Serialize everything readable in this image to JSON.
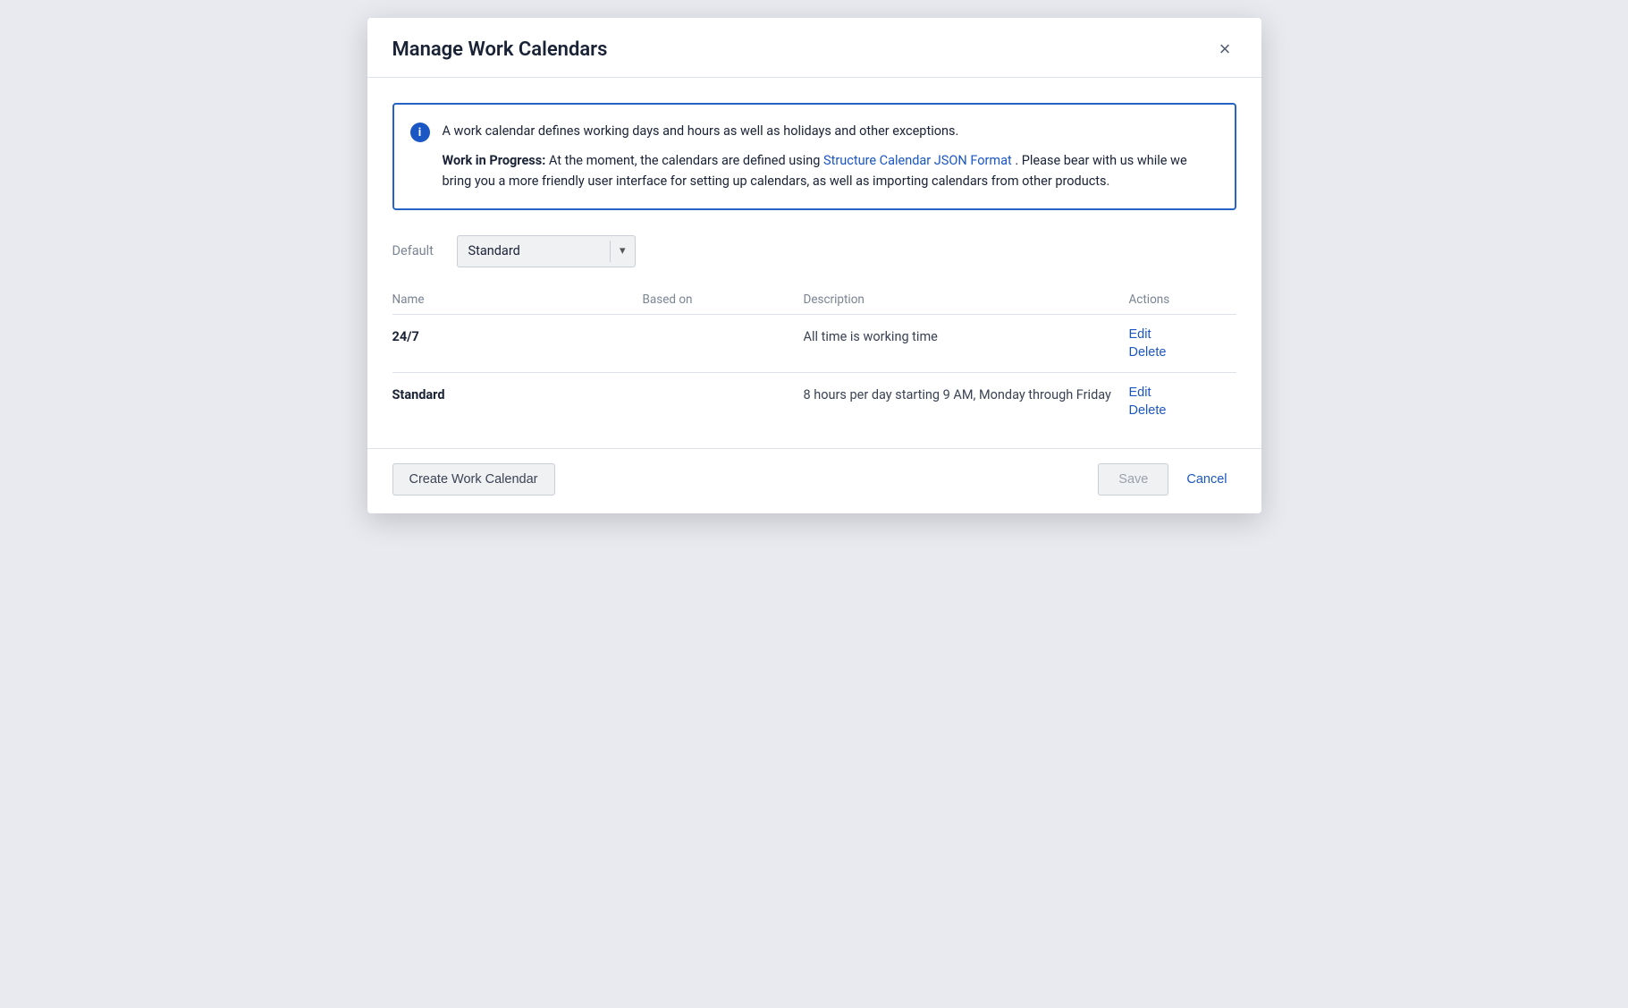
{
  "dialog": {
    "title": "Manage Work Calendars",
    "close_label": "×"
  },
  "info_box": {
    "icon": "i",
    "line1": "A work calendar defines working days and hours as well as holidays and other exceptions.",
    "wip_prefix": "Work in Progress:",
    "wip_text": " At the moment, the calendars are defined using ",
    "link_text": "Structure Calendar JSON Format",
    "line2_suffix": ". Please bear with us while we bring you a more friendly user interface for setting up calendars, as well as importing calendars from other products."
  },
  "default_section": {
    "label": "Default",
    "selected_value": "Standard",
    "chevron": "▾"
  },
  "table": {
    "headers": {
      "name": "Name",
      "based_on": "Based on",
      "description": "Description",
      "actions": "Actions"
    },
    "rows": [
      {
        "name": "24/7",
        "based_on": "",
        "description": "All time is working time",
        "actions": [
          "Edit",
          "Delete"
        ]
      },
      {
        "name": "Standard",
        "based_on": "",
        "description": "8 hours per day starting 9 AM, Monday through Friday",
        "actions": [
          "Edit",
          "Delete"
        ]
      }
    ]
  },
  "footer": {
    "create_button": "Create Work Calendar",
    "save_button": "Save",
    "cancel_button": "Cancel"
  },
  "colors": {
    "accent": "#1a56c4",
    "border": "#2563c4",
    "text_muted": "#7a8494"
  }
}
